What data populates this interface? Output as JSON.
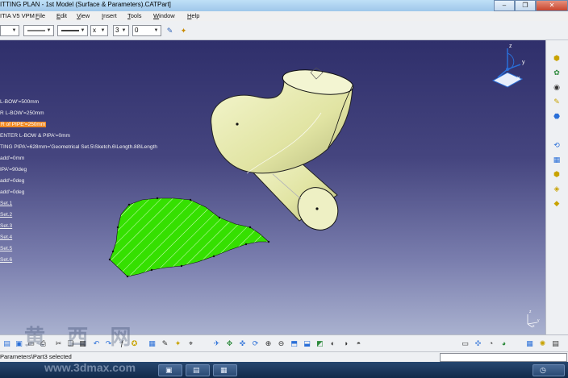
{
  "window": {
    "title": "ITTING PLAN - 1st Model (Surface & Parameters).CATPart]",
    "minimize_label": "–",
    "restore_label": "❐",
    "close_label": "✕"
  },
  "menubar": {
    "app_name": "ITIA V5 VPM",
    "items": [
      "File",
      "Edit",
      "Insert",
      "Tools",
      "Window",
      "Help"
    ]
  },
  "toolbar_top": {
    "linetype_value": "",
    "thickness_value": "",
    "point_value": "x",
    "layer_value": "3",
    "layer_index": "0"
  },
  "tree": {
    "items": [
      {
        "text": "L-BOW'=500mm",
        "highlight": false,
        "underline": false
      },
      {
        "text": "R L-BOW'=250mm",
        "highlight": false,
        "underline": false
      },
      {
        "text": "R of PIPE'=250mm",
        "highlight": true,
        "underline": false
      },
      {
        "text": "ENTER L-BOW & PIPA'=0mm",
        "highlight": false,
        "underline": false
      },
      {
        "text": "TING PIPA'=628mm='Geometrical Set.5\\Sketch.6\\Length.88\\Length",
        "highlight": false,
        "underline": false
      },
      {
        "text": "add'=0mm",
        "highlight": false,
        "underline": false
      },
      {
        "text": "IPA'=90deg",
        "highlight": false,
        "underline": false
      },
      {
        "text": "add'=0deg",
        "highlight": false,
        "underline": false
      },
      {
        "text": "add'=0deg",
        "highlight": false,
        "underline": false
      },
      {
        "text": "Set.1",
        "highlight": false,
        "underline": true
      },
      {
        "text": "Set.2",
        "highlight": false,
        "underline": true
      },
      {
        "text": "Set.3",
        "highlight": false,
        "underline": true
      },
      {
        "text": "Set.4",
        "highlight": false,
        "underline": true
      },
      {
        "text": "Set.5",
        "highlight": false,
        "underline": true
      },
      {
        "text": "Set.6",
        "highlight": false,
        "underline": true
      }
    ]
  },
  "compass": {
    "axis_x": "x",
    "axis_y": "y",
    "axis_z": "z"
  },
  "axis_badge": {
    "axis_x": "x",
    "axis_y": "y",
    "axis_z": "z"
  },
  "status": {
    "text": "Parameters\\Part3 selected"
  },
  "watermark": {
    "text": "黄 西 网",
    "url": "www.3dmax.com"
  },
  "colors": {
    "elbow_fill": "#e7eab0",
    "flat_pattern": "#33e000",
    "highlight": "#f08a24"
  }
}
